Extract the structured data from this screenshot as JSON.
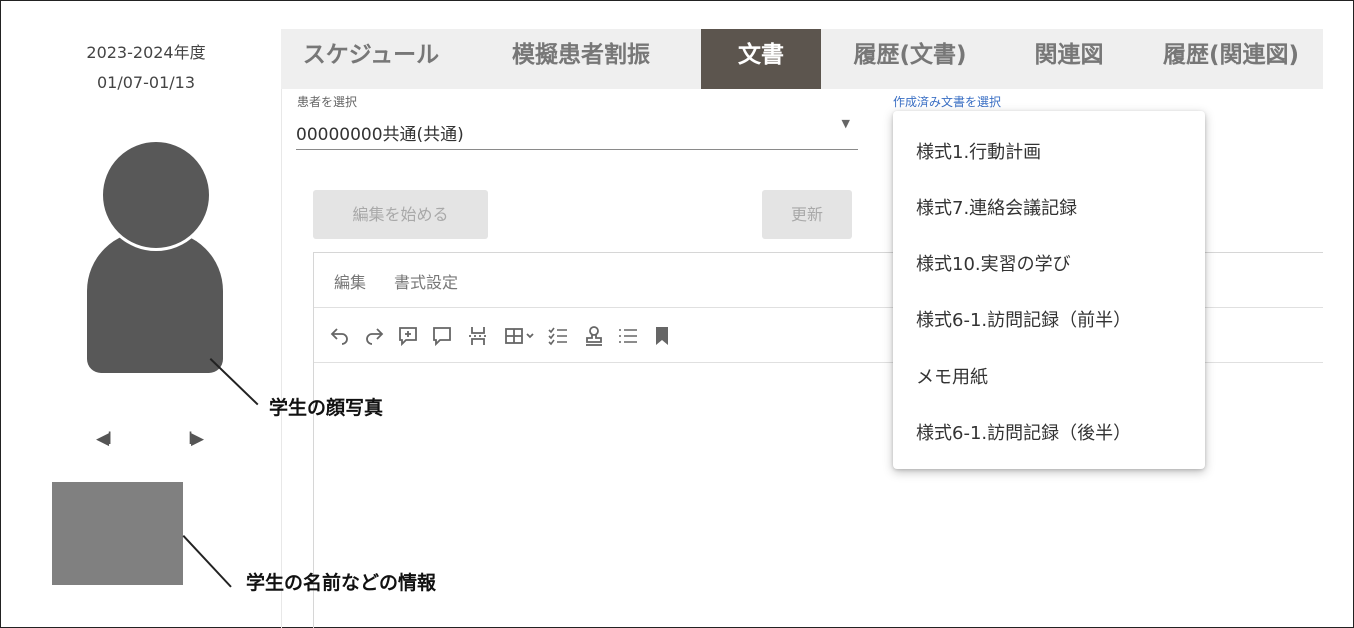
{
  "student": {
    "year": "2023-2024年度",
    "week": "01/07-01/13",
    "prev_arrow": "◀I",
    "next_arrow": "I▶"
  },
  "tabs": [
    {
      "label": "スケジュール",
      "active": false
    },
    {
      "label": "模擬患者割振",
      "active": false
    },
    {
      "label": "文書",
      "active": true
    },
    {
      "label": "履歴(文書)",
      "active": false
    },
    {
      "label": "関連図",
      "active": false
    },
    {
      "label": "履歴(関連図)",
      "active": false
    }
  ],
  "patient_select": {
    "label": "患者を選択",
    "value": "00000000共通(共通)",
    "caret": "▼"
  },
  "document_select": {
    "label": "作成済み文書を選択",
    "options": [
      "様式1.行動計画",
      "様式7.連絡会議記録",
      "様式10.実習の学び",
      "様式6-1.訪問記録（前半）",
      "メモ用紙",
      "様式6-1.訪問記録（後半）"
    ]
  },
  "buttons": {
    "start_edit": "編集を始める",
    "update": "更新"
  },
  "editor": {
    "menu": [
      "編集",
      "書式設定"
    ],
    "toolbar_icons": [
      "undo-icon",
      "redo-icon",
      "add-comment-icon",
      "comment-icon",
      "page-break-icon",
      "table-icon",
      "checklist-icon",
      "stamp-icon",
      "list-icon",
      "bookmark-icon"
    ]
  },
  "annotations": {
    "photo": "学生の顔写真",
    "info": "学生の名前などの情報"
  },
  "colors": {
    "active_tab": "#5c554e",
    "tab_bar": "#efefef",
    "placeholder_gray": "#808080",
    "avatar_gray": "#585858",
    "link_blue": "#3a6fc4"
  }
}
